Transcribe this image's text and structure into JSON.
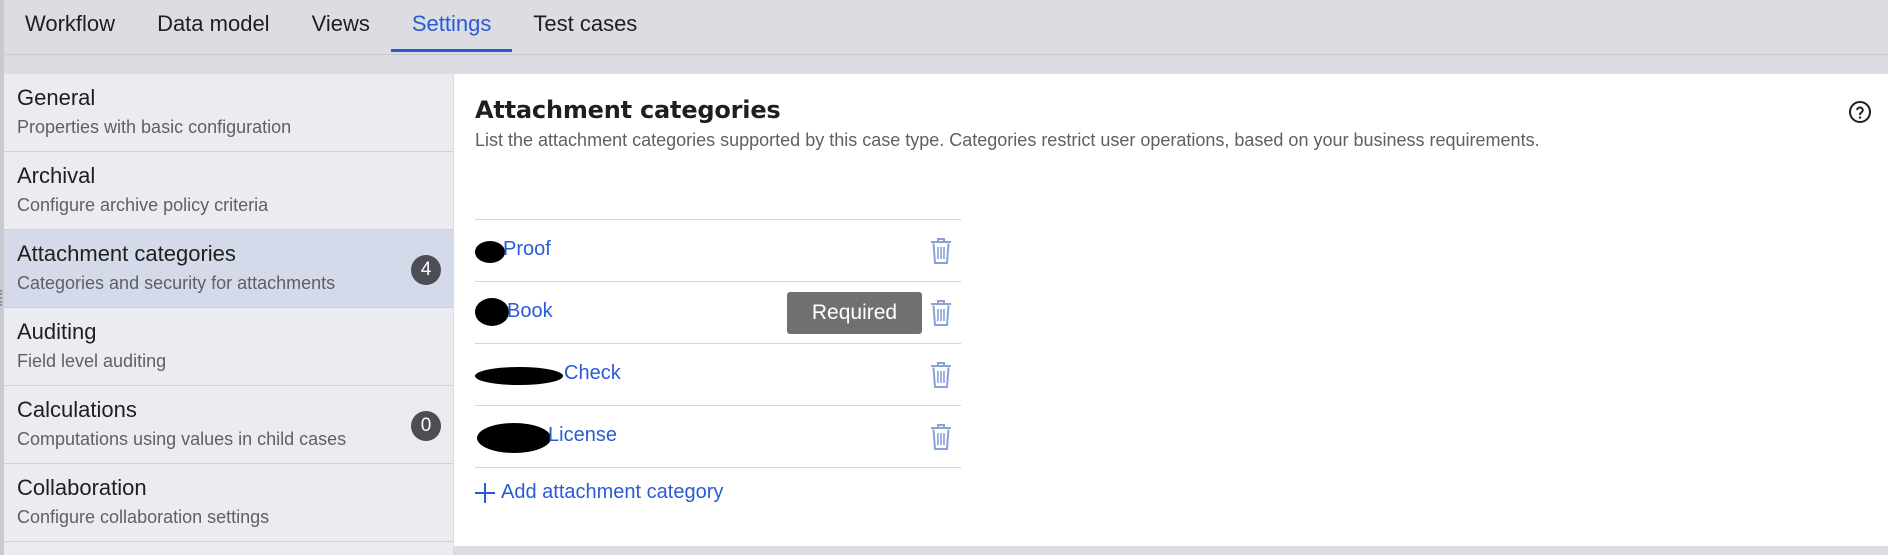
{
  "tabs": [
    {
      "label": "Workflow"
    },
    {
      "label": "Data model"
    },
    {
      "label": "Views"
    },
    {
      "label": "Settings"
    },
    {
      "label": "Test cases"
    }
  ],
  "active_tab": "Settings",
  "sidebar": {
    "items": [
      {
        "title": "General",
        "desc": "Properties with basic configuration",
        "badge": null
      },
      {
        "title": "Archival",
        "desc": "Configure archive policy criteria",
        "badge": null
      },
      {
        "title": "Attachment categories",
        "desc": "Categories and security for attachments",
        "badge": "4"
      },
      {
        "title": "Auditing",
        "desc": "Field level auditing",
        "badge": null
      },
      {
        "title": "Calculations",
        "desc": "Computations using values in child cases",
        "badge": "0"
      },
      {
        "title": "Collaboration",
        "desc": "Configure collaboration settings",
        "badge": null
      }
    ],
    "selected_index": 2
  },
  "main": {
    "title": "Attachment categories",
    "description": "List the attachment categories supported by this case type. Categories restrict user operations, based on your business requirements.",
    "help_icon": "help-circle-icon",
    "categories": [
      {
        "label": "Proof",
        "required": false
      },
      {
        "label": "Book",
        "required": true,
        "badge": "Required"
      },
      {
        "label": "Check",
        "required": false
      },
      {
        "label": "License",
        "required": false
      }
    ],
    "add_label": "Add attachment category"
  },
  "colors": {
    "accent": "#2a5bd7",
    "selected_nav_bg": "#d5daea",
    "badge_bg": "#4c4d55",
    "required_badge_bg": "#707070",
    "trash_icon": "#8aa2d8"
  }
}
